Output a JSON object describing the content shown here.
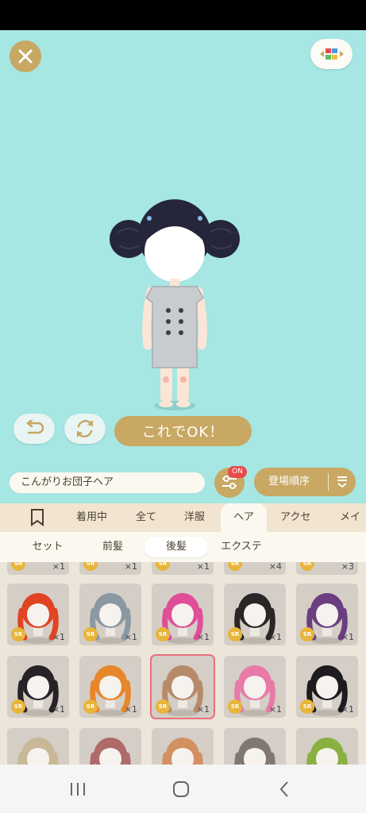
{
  "stage": {
    "ok_button": "これでOK！"
  },
  "item_bar": {
    "item_name": "こんがりお団子ヘア",
    "filter_badge": "ON",
    "sort_label": "登場順序"
  },
  "tabs": [
    {
      "label": "着用中"
    },
    {
      "label": "全て"
    },
    {
      "label": "洋服"
    },
    {
      "label": "ヘア"
    },
    {
      "label": "アクセ"
    },
    {
      "label": "メイク"
    }
  ],
  "subtabs": [
    {
      "label": "セット"
    },
    {
      "label": "前髪"
    },
    {
      "label": "後髪"
    },
    {
      "label": "エクステ"
    }
  ],
  "items_row0": [
    {
      "rarity": "SR",
      "count": "×1"
    },
    {
      "rarity": "SR",
      "count": "×1"
    },
    {
      "rarity": "SR",
      "count": "×1"
    },
    {
      "rarity": "SR",
      "count": "×4"
    },
    {
      "rarity": "SR",
      "count": "×3"
    }
  ],
  "items_row1": [
    {
      "rarity": "SR",
      "count": "×1",
      "hair_color": "#e04422"
    },
    {
      "rarity": "SR",
      "count": "×1",
      "hair_color": "#8a98a2"
    },
    {
      "rarity": "SR",
      "count": "×1",
      "hair_color": "#e04e98"
    },
    {
      "rarity": "SR",
      "count": "×1",
      "hair_color": "#2b2626"
    },
    {
      "rarity": "SR",
      "count": "×1",
      "hair_color": "#6a3e80"
    }
  ],
  "items_row2": [
    {
      "rarity": "SR",
      "count": "×1",
      "hair_color": "#262226"
    },
    {
      "rarity": "SR",
      "count": "×1",
      "hair_color": "#e8862a"
    },
    {
      "rarity": "SR",
      "count": "×1",
      "hair_color": "#b78a6a"
    },
    {
      "rarity": "SR",
      "count": "×1",
      "hair_color": "#e87aa8"
    },
    {
      "rarity": "SR",
      "count": "×1",
      "hair_color": "#1e1b1e"
    }
  ],
  "items_row3_colors": [
    "#c8b898",
    "#b06a6a",
    "#d49060",
    "#807870",
    "#8ab040"
  ],
  "colors": {
    "accent_gold": "#c8a862",
    "stage_bg": "#a6e6e3",
    "badge_red": "#e94a4a",
    "rarity_yellow": "#e7b53a"
  }
}
